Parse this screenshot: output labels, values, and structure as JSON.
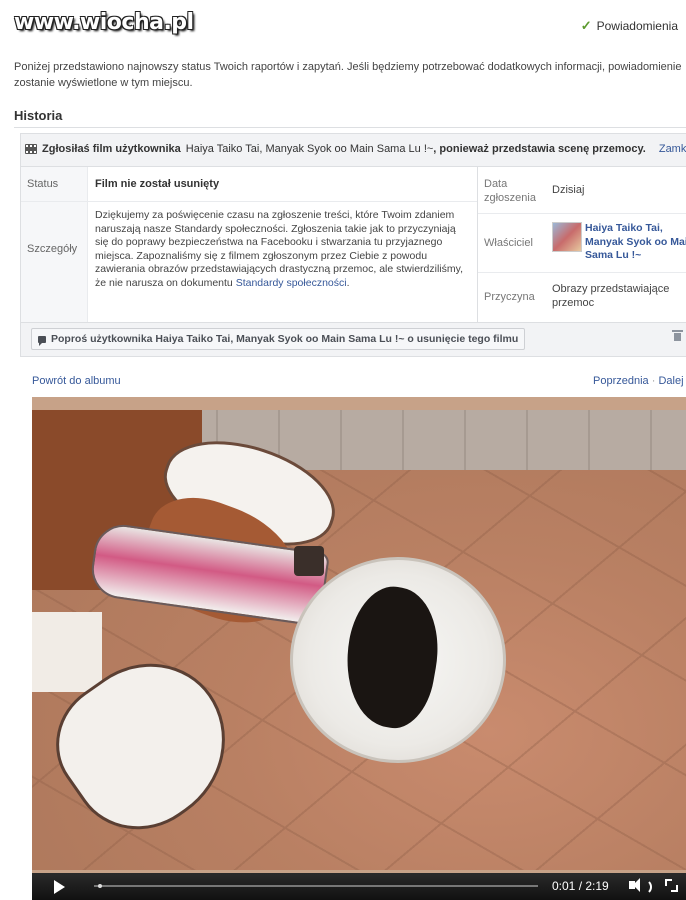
{
  "watermark": "www.wiocha.pl",
  "header": {
    "notifications_label": "Powiadomienia",
    "notifications_icon": "checkmark-icon"
  },
  "intro": "Poniżej przedstawiono najnowszy status Twoich raportów i zapytań. Jeśli będziemy potrzebować dodatkowych informacji, powiadomienie zostanie wyświetlone w tym miejscu.",
  "section_title": "Historia",
  "report": {
    "head_prefix": "Zgłosiłaś film użytkownika",
    "head_user": "Haiya Taiko Tai, Manyak Syok oo Main Sama Lu !~",
    "head_suffix": ", ponieważ przedstawia scenę przemocy.",
    "close_label": "Zamknij",
    "status_label": "Status",
    "status_value": "Film nie został usunięty",
    "details_label": "Szczegóły",
    "details_text": "Dziękujemy za poświęcenie czasu na zgłoszenie treści, które Twoim zdaniem naruszają nasze Standardy społeczności. Zgłoszenia takie jak to przyczyniają się do poprawy bezpieczeństwa na Facebooku i stwarzania tu przyjaznego miejsca. Zapoznaliśmy się z filmem zgłoszonym przez Ciebie z powodu zawierania obrazów przedstawiających drastyczną przemoc, ale stwierdziliśmy, że nie narusza on dokumentu",
    "details_link": "Standardy społeczności",
    "details_end": ".",
    "date_label": "Data zgłoszenia",
    "date_value": "Dzisiaj",
    "owner_label": "Właściciel",
    "owner_name": "Haiya Taiko Tai, Manyak Syok oo Main Sama Lu !~",
    "reason_label": "Przyczyna",
    "reason_value": "Obrazy przedstawiające przemoc",
    "ask_button": "Poproś użytkownika Haiya Taiko Tai, Manyak Syok oo Main Sama Lu !~ o usunięcie tego filmu"
  },
  "album": {
    "back_link": "Powrót do albumu",
    "prev": "Poprzednia",
    "separator": "·",
    "next": "Dalej"
  },
  "video": {
    "time": "0:01 / 2:19",
    "progress_fraction": 0.01
  }
}
